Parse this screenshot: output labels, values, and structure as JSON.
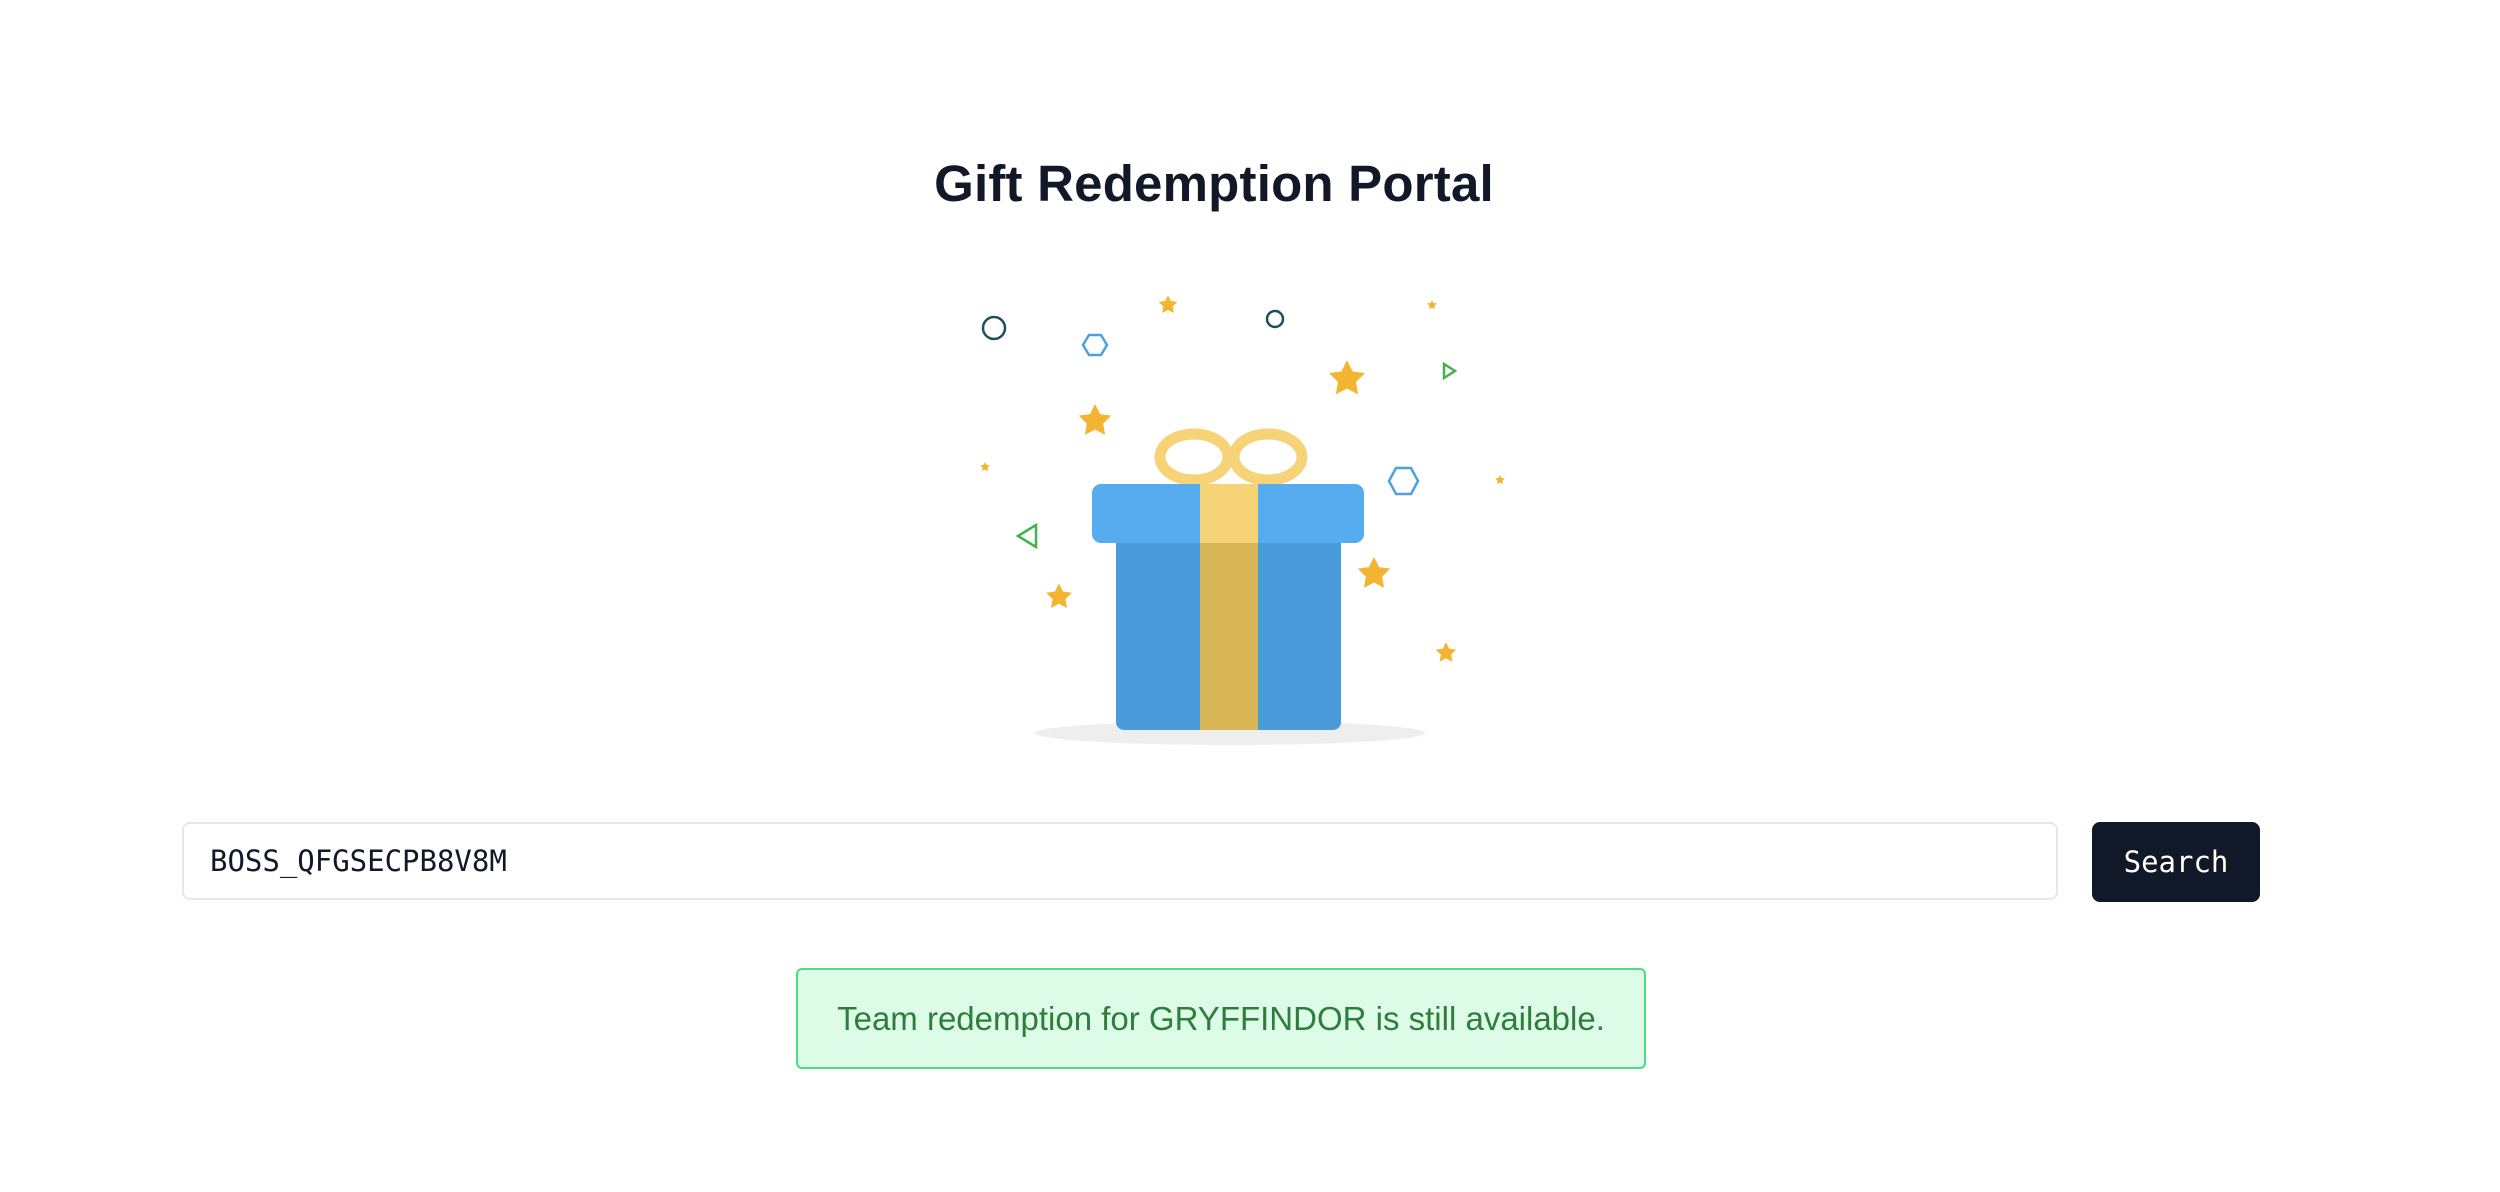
{
  "page": {
    "title": "Gift Redemption Portal"
  },
  "search": {
    "value": "BOSS_QFGSECPB8V8M",
    "placeholder": "",
    "button_label": "Search"
  },
  "status": {
    "message": "Team redemption for GRYFFINDOR is still available.",
    "type": "success"
  },
  "illustration": {
    "icon": "gift-box-icon",
    "colors": {
      "box_lid": "#56acee",
      "box_body": "#4a9bd9",
      "ribbon": "#f6d376",
      "ribbon_dark": "#d8b656",
      "stars": "#f3b531",
      "confetti_green": "#43b14e",
      "confetti_blue": "#4aa3df",
      "confetti_navy": "#1f4f5e"
    }
  },
  "colors": {
    "primary_dark": "#111827",
    "success_bg": "#dcfce7",
    "success_border": "#4ade80",
    "success_text": "#2f7d3c"
  }
}
